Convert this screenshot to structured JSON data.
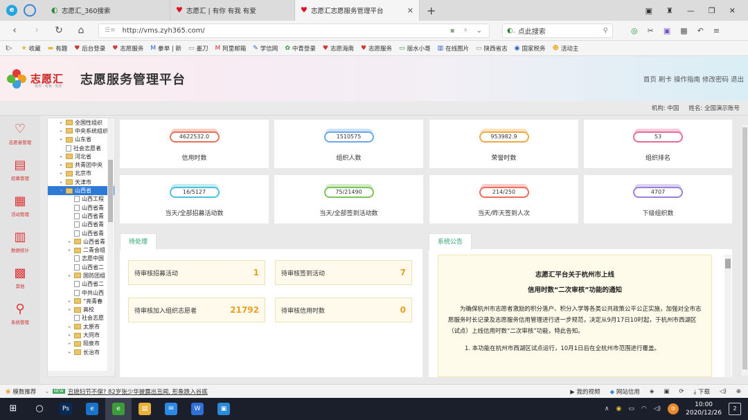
{
  "browser": {
    "tabs": [
      {
        "title": "志愿汇_360搜索",
        "active": false
      },
      {
        "title": "志愿汇 | 有你 有我 有爱",
        "active": false
      },
      {
        "title": "志愿汇志愿服务管理平台",
        "active": true
      }
    ],
    "url": "http://vms.zyh365.com/",
    "search_placeholder": "点此搜索",
    "bookmarks": [
      "收藏",
      "有趣",
      "后台登录",
      "志愿服务",
      "豢单 | 新",
      "墨刀",
      "阿里邮箱",
      "学信网",
      "中青登录",
      "志愿海南",
      "志愿服务",
      "丽水小哥",
      "在线图片",
      "陕西省志",
      "国家税务",
      "活动主"
    ]
  },
  "app": {
    "logo_text": "志愿汇",
    "logo_sub": "有你 · 有我 · 有爱",
    "title": "志愿服务管理平台",
    "header_links": [
      "首页",
      "刷卡",
      "操作指南",
      "修改密码",
      "退出"
    ],
    "org_label": "机构:",
    "org_value": "中国",
    "name_label": "姓名:",
    "name_value": "全国演示账号"
  },
  "sidenav": [
    {
      "label": "志愿者管理",
      "icon": "heart-icon",
      "glyph": "♡"
    },
    {
      "label": "招募管理",
      "icon": "clipboard-icon",
      "glyph": "▤"
    },
    {
      "label": "活动管理",
      "icon": "calendar-icon",
      "glyph": "▦"
    },
    {
      "label": "数据统计",
      "icon": "chart-icon",
      "glyph": "▥"
    },
    {
      "label": "其他",
      "icon": "grid-icon",
      "glyph": "▩"
    },
    {
      "label": "系统管理",
      "icon": "search-icon",
      "glyph": "⚲"
    }
  ],
  "tree": [
    {
      "label": "全国性组织",
      "type": "folder",
      "indent": 1
    },
    {
      "label": "中央系统组织",
      "type": "folder",
      "indent": 1
    },
    {
      "label": "山东省",
      "type": "folder",
      "indent": 1
    },
    {
      "label": "社会志愿者",
      "type": "file",
      "indent": 1
    },
    {
      "label": "河北省",
      "type": "folder",
      "indent": 1
    },
    {
      "label": "共青团中央",
      "type": "folder",
      "indent": 1
    },
    {
      "label": "北京市",
      "type": "folder",
      "indent": 1
    },
    {
      "label": "天津市",
      "type": "folder",
      "indent": 1
    },
    {
      "label": "山西省",
      "type": "folder",
      "indent": 1,
      "selected": true
    },
    {
      "label": "山西工程",
      "type": "file",
      "indent": 2
    },
    {
      "label": "山西省青",
      "type": "file",
      "indent": 2
    },
    {
      "label": "山西省青",
      "type": "file",
      "indent": 2
    },
    {
      "label": "山西省青",
      "type": "file",
      "indent": 2
    },
    {
      "label": "山西省青",
      "type": "file",
      "indent": 2
    },
    {
      "label": "山西省青",
      "type": "folder",
      "indent": 2
    },
    {
      "label": "二青会组",
      "type": "folder",
      "indent": 2
    },
    {
      "label": "志愿中国",
      "type": "file",
      "indent": 2
    },
    {
      "label": "山西省二",
      "type": "file",
      "indent": 2
    },
    {
      "label": "国防团组",
      "type": "folder",
      "indent": 2
    },
    {
      "label": "山西省二",
      "type": "file",
      "indent": 2
    },
    {
      "label": "中共山西",
      "type": "file",
      "indent": 2
    },
    {
      "label": "“亮青春",
      "type": "folder",
      "indent": 2
    },
    {
      "label": "高校",
      "type": "folder",
      "indent": 2
    },
    {
      "label": "社会志愿",
      "type": "file",
      "indent": 2
    },
    {
      "label": "太原市",
      "type": "folder",
      "indent": 2
    },
    {
      "label": "大同市",
      "type": "folder",
      "indent": 2
    },
    {
      "label": "阳泉市",
      "type": "folder",
      "indent": 2
    },
    {
      "label": "长治市",
      "type": "folder",
      "indent": 2
    }
  ],
  "stats": [
    {
      "value": "4622532.0",
      "label": "信用时数",
      "color": "#e8735a"
    },
    {
      "value": "1510575",
      "label": "组织人数",
      "color": "#6aa8e8"
    },
    {
      "value": "953982.9",
      "label": "荣誉时数",
      "color": "#f0a840"
    },
    {
      "value": "53",
      "label": "组织排名",
      "color": "#e66a9a"
    },
    {
      "value": "16/5127",
      "label": "当天/全部招募活动数",
      "color": "#4cc2d8"
    },
    {
      "value": "75/21490",
      "label": "当天/全部签到活动数",
      "color": "#7cc25a"
    },
    {
      "value": "214/250",
      "label": "当天/昨天签到人次",
      "color": "#ef6b5a"
    },
    {
      "value": "4707",
      "label": "下级组织数",
      "color": "#9a7fd6"
    }
  ],
  "pending": {
    "tab": "待处理",
    "items": [
      {
        "label": "待审核招募活动",
        "count": "1"
      },
      {
        "label": "待审核签到活动",
        "count": "7"
      },
      {
        "label": "待审核加入组织志愿者",
        "count": "21792"
      },
      {
        "label": "待审核信用时数",
        "count": "0"
      }
    ]
  },
  "announce": {
    "tab": "系统公告",
    "title1": "志愿汇平台关于杭州市上线",
    "title2": "信用时数“二次审核”功能的通知",
    "para1": "为确保杭州市志愿者激励的积分落户、积分入学等各类公共政策公平公正实施，加强对全市志愿服务时长记录及志愿服务信用管理进行进一步规范，决定从9月17日10时起，于杭州市西湖区（试点）上线信用时数“二次审核”功能，特此告知。",
    "para2": "1. 本功能在杭州市西湖区试点运行，10月1日后在全杭州市范围进行覆盖。"
  },
  "statusbar": {
    "left": "模数推荐",
    "badge": "NEW",
    "news1": "丑媳妇节不保? 82岁张少华披露出丑闻, 形象跌入谷底",
    "right": [
      "我的视频",
      "网站信用",
      "下载"
    ]
  },
  "taskbar": {
    "apps": [
      {
        "name": "windows-start",
        "glyph": "⊞",
        "color": "transparent"
      },
      {
        "name": "cortana",
        "glyph": "○",
        "color": "transparent"
      },
      {
        "name": "photoshop",
        "glyph": "Ps",
        "color": "#0a2a55"
      },
      {
        "name": "edge",
        "glyph": "e",
        "color": "#1a73c8"
      },
      {
        "name": "360-browser",
        "glyph": "e",
        "color": "#3c9c3a"
      },
      {
        "name": "explorer",
        "glyph": "▤",
        "color": "#e8b23a"
      },
      {
        "name": "mail",
        "glyph": "✉",
        "color": "#2b8ae6"
      },
      {
        "name": "wps",
        "glyph": "W",
        "color": "#2e6fd8"
      },
      {
        "name": "app",
        "glyph": "▣",
        "color": "#2a8ad8"
      }
    ],
    "time": "10:00",
    "date": "2020/12/26",
    "notif": "2"
  }
}
